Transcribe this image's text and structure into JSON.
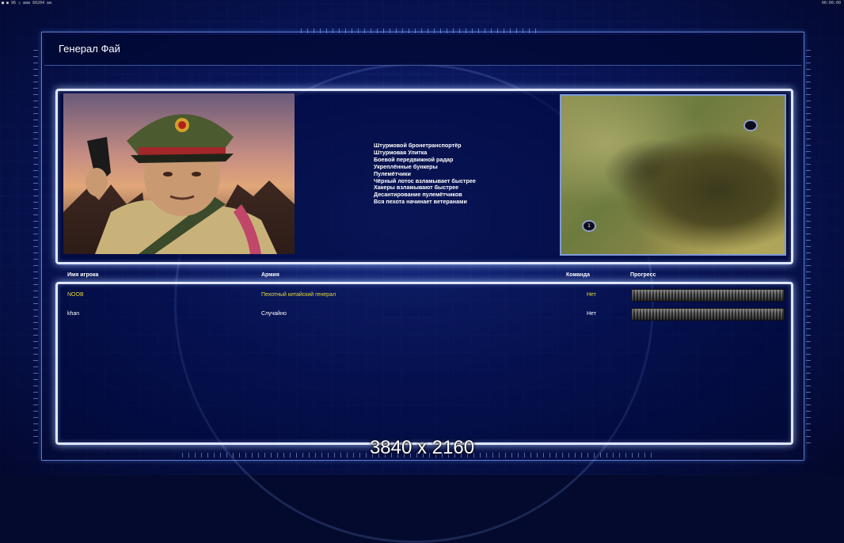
{
  "window": {
    "top_left_text": "■ ● 96 ▯ ⊡⊡⊡ 60204 ⊡⊡",
    "top_right_text": "00:00:00"
  },
  "header": {
    "title": "Генерал Фай"
  },
  "general": {
    "features": [
      "Штурмовой бронетранспортёр",
      "Штурмовая Улитка",
      "Боевой передвижной радар",
      "Укреплённые бункеры",
      "Пулемётчики",
      "Чёрный лотос взламывает быстрее",
      "Хакеры взламывают быстрее",
      "Десантирование пулемётчиков",
      "Вся пехота начинает ветеранами"
    ]
  },
  "map": {
    "markers": [
      {
        "label": ""
      },
      {
        "label": "1"
      }
    ]
  },
  "players_table": {
    "headers": {
      "name": "Имя игрока",
      "army": "Армия",
      "team": "Команда",
      "progress": "Прогресс"
    },
    "rows": [
      {
        "name": "NOOB",
        "army": "Пехотный китайский генерал",
        "team": "Нет",
        "progress": 0,
        "color": "#e8d73a"
      },
      {
        "name": "khan",
        "army": "Случайно",
        "team": "Нет",
        "progress": 0,
        "color": "#ffffff"
      }
    ]
  },
  "overlay": {
    "resolution": "3840 x 2160"
  },
  "colors": {
    "accent": "#dfe6ff",
    "background": "#06104a",
    "highlight_player": "#e8d73a"
  }
}
